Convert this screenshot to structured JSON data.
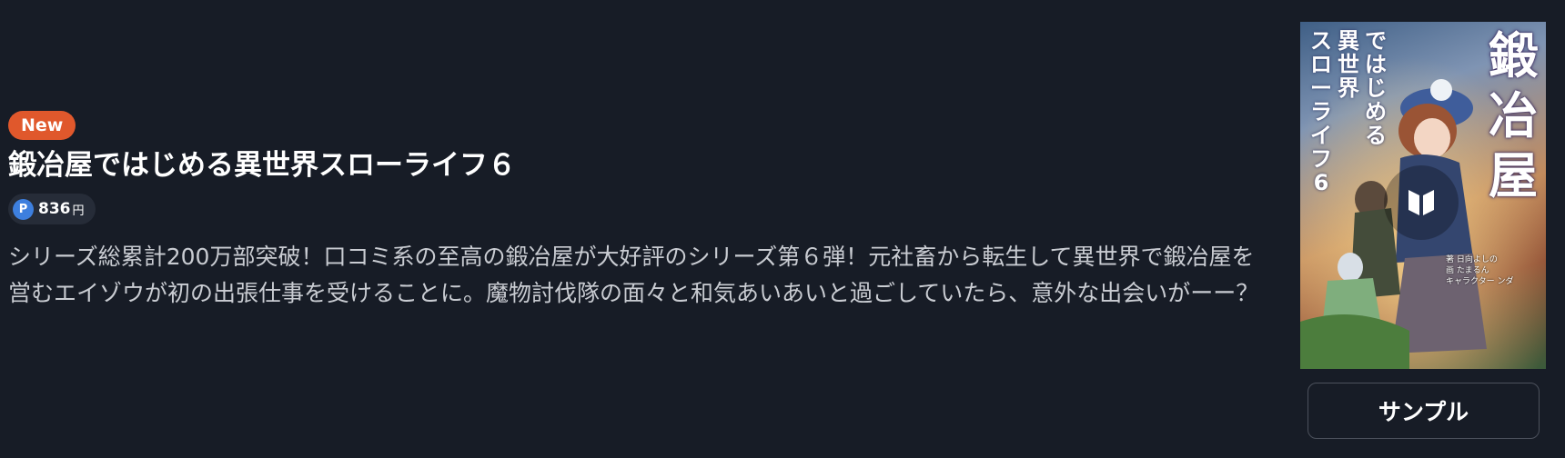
{
  "product": {
    "badge": "New",
    "title": "鍛冶屋ではじめる異世界スローライフ６",
    "price": {
      "point_icon": "P",
      "value": "836",
      "unit": "円"
    },
    "description": "シリーズ総累計200万部突破！口コミ系の至高の鍛冶屋が大好評のシリーズ第６弾！元社畜から転生して異世界で鍛冶屋を営むエイゾウが初の出張仕事を受けることに。魔物討伐隊の面々と和気あいあいと過ごしていたら、意外な出会いがーー？"
  },
  "cover": {
    "title_main": "鍛冶屋",
    "subtitle_line1": "ではじめる",
    "subtitle_line2": "異世界",
    "subtitle_line3": "スローライフ6",
    "credits": [
      "著 日向よしの",
      "画 たまるん",
      "キャラクター ンダ"
    ],
    "play_icon": "read-sample-icon"
  },
  "actions": {
    "sample_label": "サンプル"
  },
  "colors": {
    "background": "#171c26",
    "new_badge": "#e0582c",
    "point_blue": "#3d7fde",
    "description_text": "#c9ccd2"
  }
}
